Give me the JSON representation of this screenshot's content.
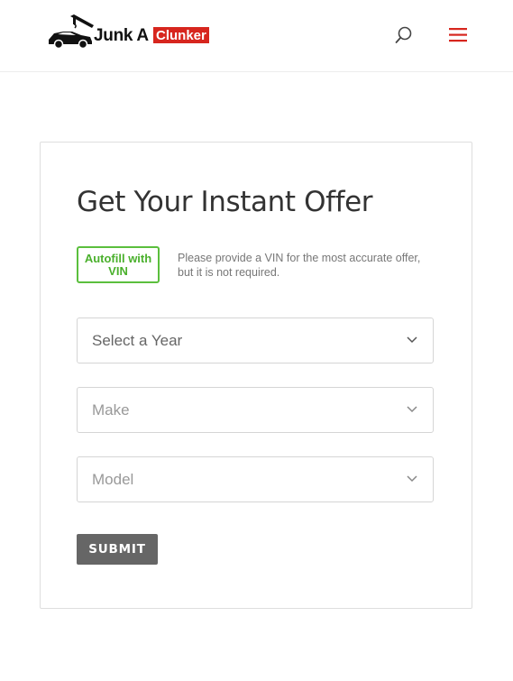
{
  "header": {
    "logo_text": "Junk A",
    "logo_badge": "Clunker",
    "search_icon": "search-icon",
    "menu_icon": "hamburger-menu-icon",
    "accent_color": "#d7261e"
  },
  "form": {
    "title": "Get Your Instant Offer",
    "vin_button_label": "Autofill with VIN",
    "vin_note": "Please provide a VIN for the most accurate offer, but it is not required.",
    "year_select": "Select a Year",
    "make_select": "Make",
    "model_select": "Model",
    "submit_label": "SUBMIT",
    "vin_color": "#5bbf3d"
  }
}
